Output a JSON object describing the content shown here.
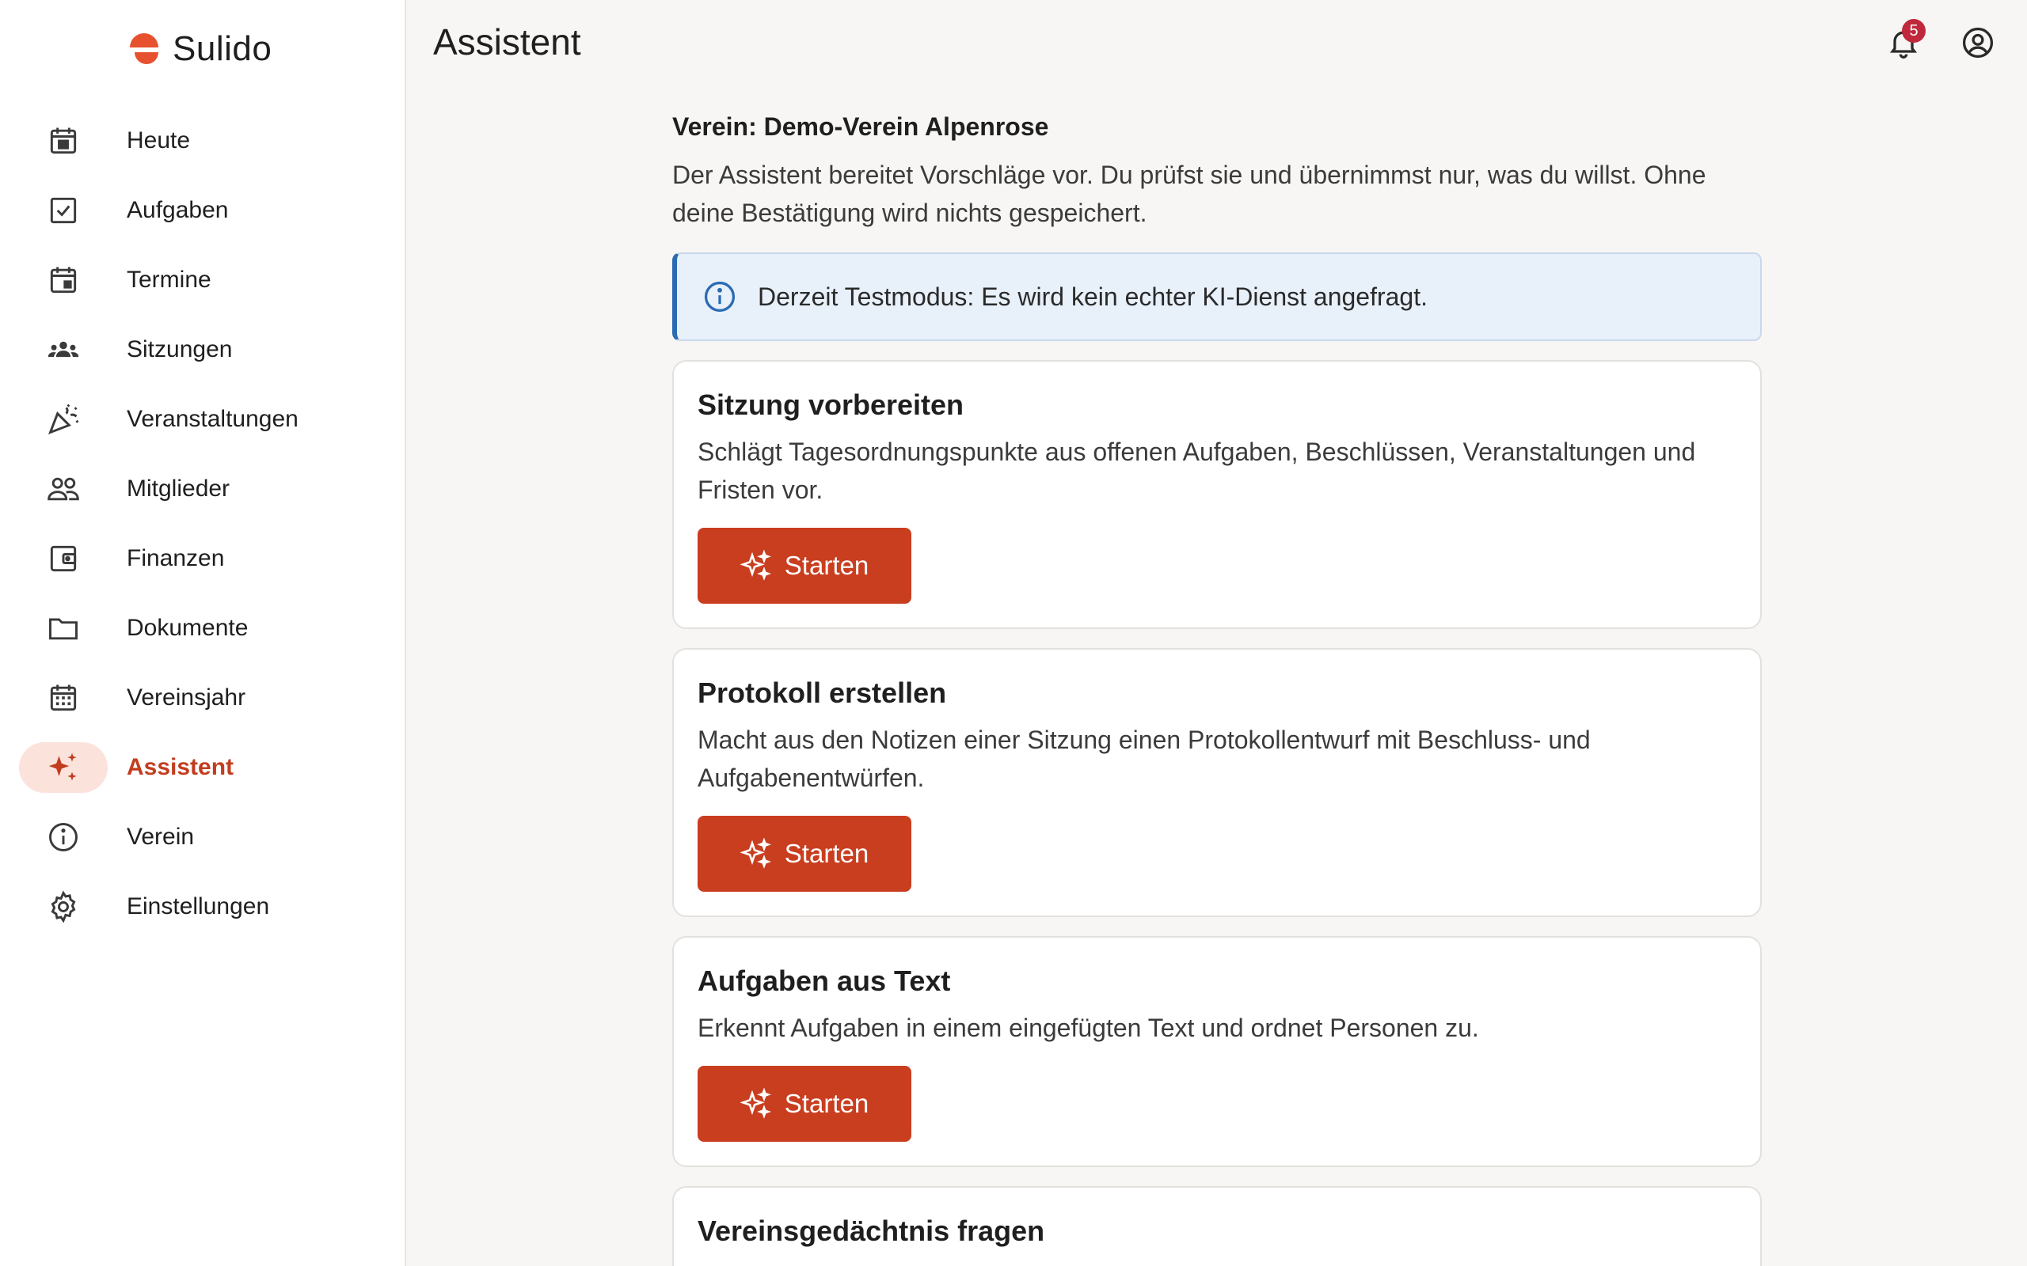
{
  "brand": {
    "name": "Sulido",
    "accent": "#e8512e"
  },
  "sidebar": {
    "items": [
      {
        "label": "Heute",
        "icon": "calendar-today-icon"
      },
      {
        "label": "Aufgaben",
        "icon": "checkbox-icon"
      },
      {
        "label": "Termine",
        "icon": "calendar-event-icon"
      },
      {
        "label": "Sitzungen",
        "icon": "groups-icon"
      },
      {
        "label": "Veranstaltungen",
        "icon": "celebration-icon"
      },
      {
        "label": "Mitglieder",
        "icon": "people-icon"
      },
      {
        "label": "Finanzen",
        "icon": "wallet-icon"
      },
      {
        "label": "Dokumente",
        "icon": "folder-icon"
      },
      {
        "label": "Vereinsjahr",
        "icon": "calendar-month-icon"
      },
      {
        "label": "Assistent",
        "icon": "sparkle-icon",
        "active": true
      },
      {
        "label": "Verein",
        "icon": "info-icon"
      },
      {
        "label": "Einstellungen",
        "icon": "gear-icon"
      }
    ]
  },
  "header": {
    "title": "Assistent",
    "notification_count": "5"
  },
  "main": {
    "verein_line": "Verein: Demo-Verein Alpenrose",
    "intro": "Der Assistent bereitet Vorschläge vor. Du prüfst sie und übernimmst nur, was du willst. Ohne deine Bestätigung wird nichts gespeichert.",
    "info": "Derzeit Testmodus: Es wird kein echter KI-Dienst angefragt.",
    "cards": [
      {
        "title": "Sitzung vorbereiten",
        "description": "Schlägt Tagesordnungspunkte aus offenen Aufgaben, Beschlüssen, Veranstaltungen und Fristen vor.",
        "button": "Starten"
      },
      {
        "title": "Protokoll erstellen",
        "description": "Macht aus den Notizen einer Sitzung einen Protokollentwurf mit Beschluss- und Aufgabenentwürfen.",
        "button": "Starten"
      },
      {
        "title": "Aufgaben aus Text",
        "description": "Erkennt Aufgaben in einem eingefügten Text und ordnet Personen zu.",
        "button": "Starten"
      },
      {
        "title": "Vereinsgedächtnis fragen"
      }
    ]
  }
}
